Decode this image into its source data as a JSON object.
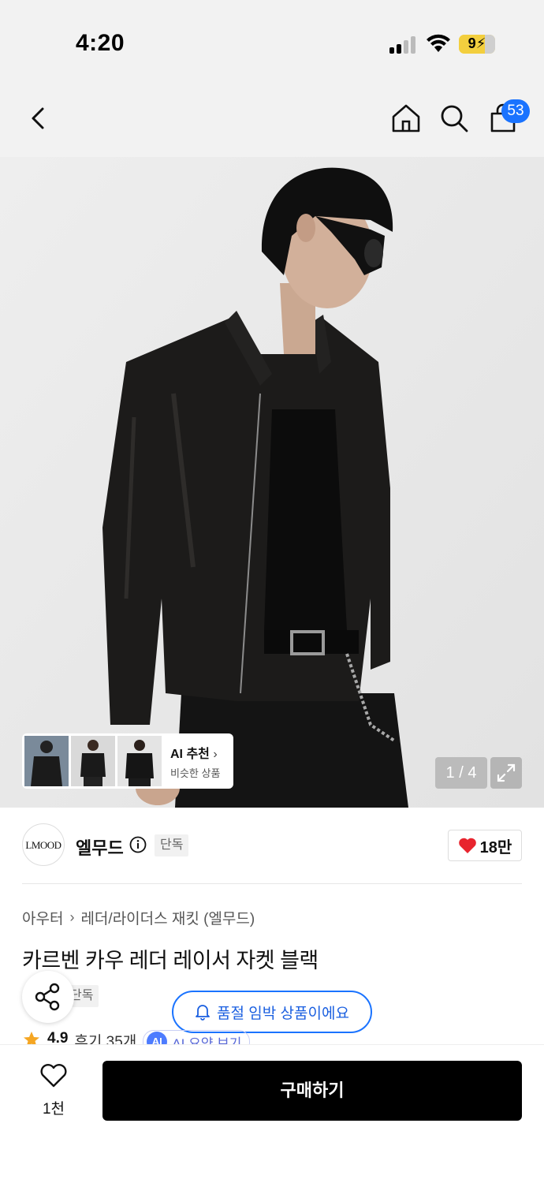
{
  "status_bar": {
    "time": "4:20",
    "battery": "9"
  },
  "header": {
    "cart_count": "53"
  },
  "product_image": {
    "counter": "1 / 4"
  },
  "ai_recommend": {
    "title": "AI 추천",
    "subtitle": "비슷한 상품"
  },
  "brand": {
    "logo_text": "LMOOD",
    "name": "엘무드",
    "badge": "단독",
    "like_count": "18만"
  },
  "breadcrumb": {
    "items": [
      "아우터",
      "레더/라이더스 재킷 (엘무드)"
    ]
  },
  "product": {
    "title": "카르벤 카우 레더 레이서 자켓 블랙",
    "badge": "단독"
  },
  "soldout_notice": "품절 임박 상품이에요",
  "rating": {
    "score": "4.9",
    "reviews": "후기 35개",
    "ai_summary": "AI 요약 보기",
    "ai_badge": "AI"
  },
  "bottom_bar": {
    "wish_count": "1천",
    "buy_label": "구매하기"
  },
  "colors": {
    "accent_blue": "#1a73ff",
    "heart_red": "#e8242e",
    "buy_button": "#000000",
    "star": "#f5a623"
  }
}
